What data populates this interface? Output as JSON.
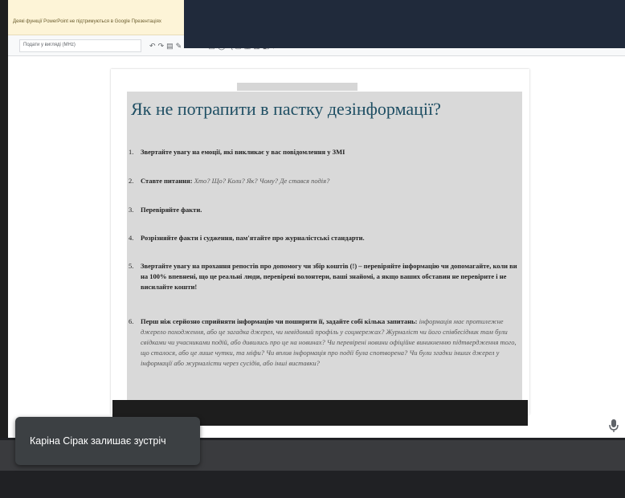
{
  "infobar": {
    "message": "Деякі функції PowerPoint не підтримуються в Google Презентаціях"
  },
  "toolbar": {
    "font_value": "Подати у вигляді (MHz)"
  },
  "slide": {
    "title": "Як не потрапити в пастку дезінформації?",
    "items": [
      {
        "num": "1.",
        "bold": "Звертайте увагу на емоції, які викликає у вас повідомлення у ЗМІ",
        "rest": ""
      },
      {
        "num": "2.",
        "bold": "Ставте питання:",
        "rest": "Хто? Що? Коли? Як? Чому? Де стався подія?"
      },
      {
        "num": "3.",
        "bold": "Перевіряйте факти.",
        "rest": ""
      },
      {
        "num": "4.",
        "bold": "Розрізняйте факти і судження, пам'ятайте про журналістські стандарти.",
        "rest": ""
      },
      {
        "num": "5.",
        "bold": "Звертайте увагу на прохання репостів про допомогу чи збір коштів (!) – перевіряйте інформацію чи допомагайте, коли ви на 100% впевнені, що це реальні люди, перевірені волонтери, ваші знайомі, а якщо ваших обставин не перевірите і не висилайте кошти!",
        "rest": ""
      },
      {
        "num": "6.",
        "bold": "Перш ніж серйозно сприйняти інформацію чи поширити її, задайте собі кілька запитань:",
        "rest": "інформація має протилежне джерело походження, або це загадка джерел, чи невідомий профіль у соцмережах? Журналіст чи його співбесідник там були свідками чи учасниками подій, або дивились про це на новинах? Чи перевірені новини офіційне виникненню підтвердження того, що сталося, або це лише чутки, та міфи? Чи вплив інформація про події була спотворена? Чи були згадки інших джерел у інформації або журналісти через сусідів, або інші виставки?"
      }
    ]
  },
  "toast": {
    "message": "Каріна Сірак залишає зустріч"
  }
}
